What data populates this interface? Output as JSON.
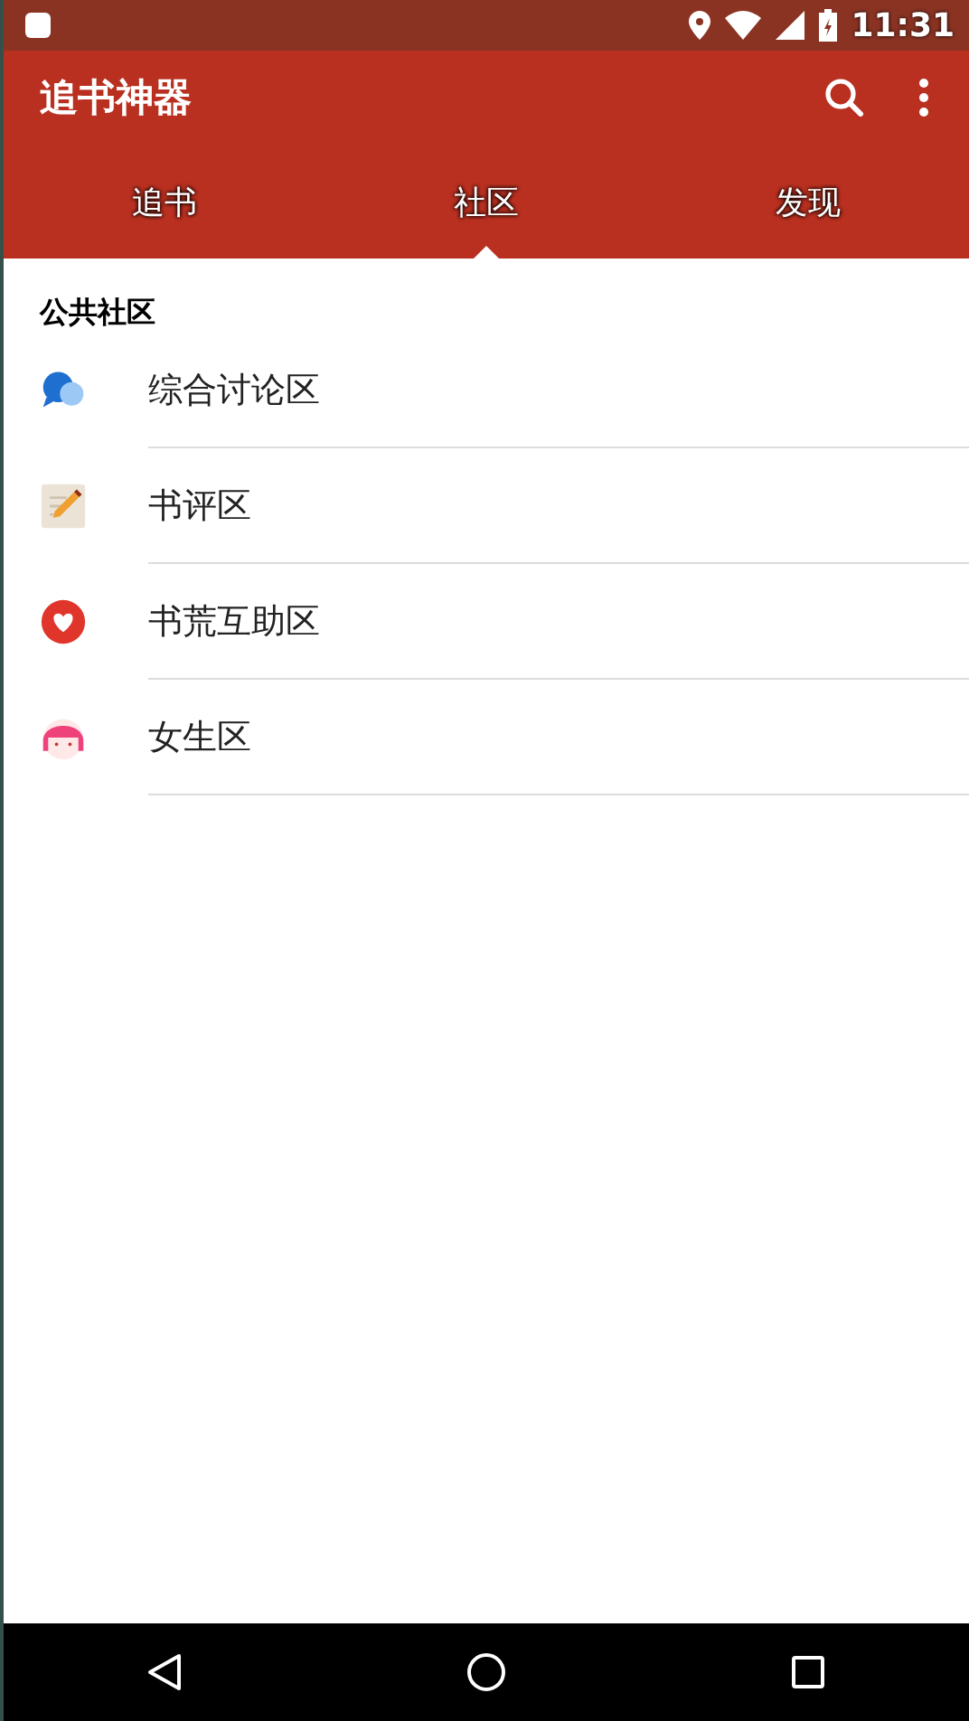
{
  "status_bar": {
    "time": "11:31"
  },
  "app_bar": {
    "title": "追书神器"
  },
  "tabs": [
    {
      "label": "追书",
      "selected": false
    },
    {
      "label": "社区",
      "selected": true
    },
    {
      "label": "发现",
      "selected": false
    }
  ],
  "section": {
    "title": "公共社区",
    "items": [
      {
        "kind": "chat",
        "label": "综合讨论区"
      },
      {
        "kind": "pencil",
        "label": "书评区"
      },
      {
        "kind": "heart",
        "label": "书荒互助区"
      },
      {
        "kind": "girl",
        "label": "女生区"
      }
    ]
  }
}
